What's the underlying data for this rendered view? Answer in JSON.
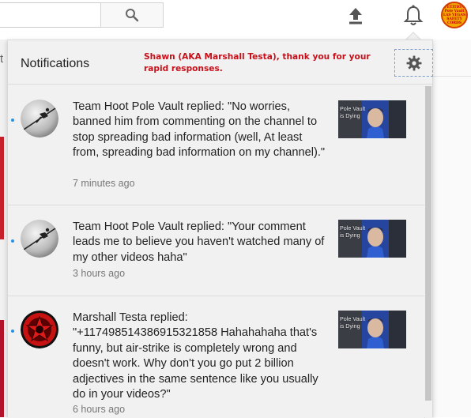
{
  "topbar": {
    "search_icon": "search-icon",
    "upload_icon": "upload-icon",
    "bell_icon": "bell-icon",
    "avatar_text": [
      "PETITION",
      "Pole Vault",
      "LAS VEGAS",
      "SAFETY",
      "CORDS"
    ]
  },
  "background": {
    "partial_letter": "t"
  },
  "notifications_panel": {
    "title": "Notifications",
    "annotation": "Shawn (AKA Marshall Testa), thank you for your rapid responses.",
    "settings_icon": "gear-icon",
    "items": [
      {
        "text": "Team Hoot Pole Vault replied: \"No worries, banned him from commenting on the channel to stop spreading bad information (well, At least from, spreading bad information on my channel).\"",
        "time": "7 minutes ago",
        "thumbnail_label": "Pole Vault is Dying"
      },
      {
        "text": "Team Hoot Pole Vault replied: \"Your comment leads me to believe you haven't watched many of my other videos haha\"",
        "time": "3 hours ago",
        "thumbnail_label": "Pole Vault is Dying"
      },
      {
        "text": "Marshall Testa replied: \"+117498514386915321858 Hahahahaha that's funny, but air-strike is completely wrong and doesn't work. Why don't you go put 2 billion adjectives in the same sentence like you usually do in your videos?\"",
        "time": "6 hours ago",
        "thumbnail_label": "Pole Vault is Dying"
      }
    ]
  },
  "colors": {
    "accent_unread": "#2793e6",
    "annotation_red": "#c8101a",
    "thumbnail_blue": "#1e3b9c"
  }
}
